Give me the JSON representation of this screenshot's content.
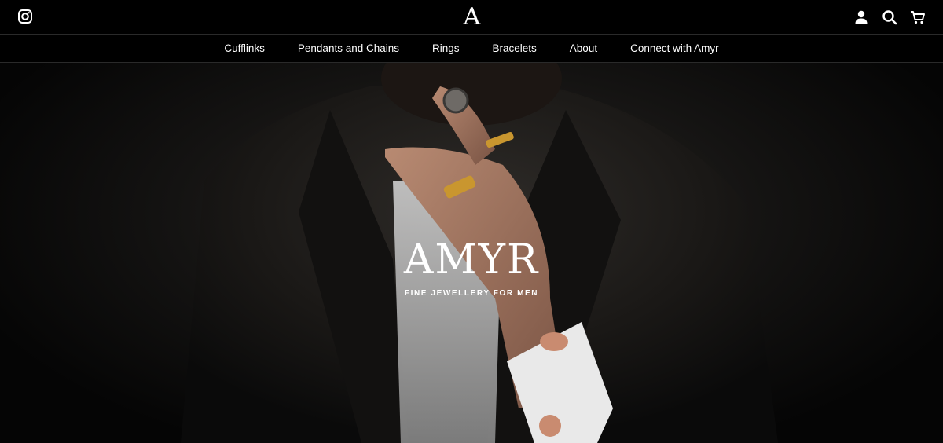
{
  "header": {
    "logo_letter": "A",
    "icons": [
      "instagram-icon",
      "account-icon",
      "search-icon",
      "cart-icon"
    ]
  },
  "nav": {
    "items": [
      {
        "label": "Cufflinks"
      },
      {
        "label": "Pendants and Chains"
      },
      {
        "label": "Rings"
      },
      {
        "label": "Bracelets"
      },
      {
        "label": "About"
      },
      {
        "label": "Connect with Amyr"
      }
    ]
  },
  "hero": {
    "brand": "AMYR",
    "tagline": "FINE JEWELLERY FOR MEN"
  },
  "colors": {
    "background": "#000000",
    "text": "#ffffff",
    "gold": "#c9962f",
    "rose_gold": "#c98b70"
  }
}
